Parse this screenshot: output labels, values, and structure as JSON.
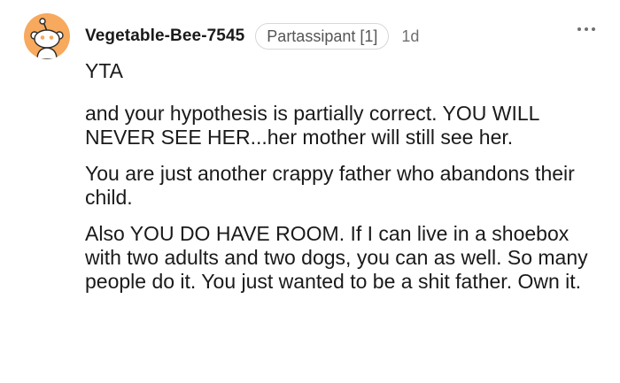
{
  "comment": {
    "username": "Vegetable-Bee-7545",
    "flair": "Partassipant [1]",
    "age": "1d",
    "more_icon": "more-horizontal-icon",
    "avatar_icon": "snoo-avatar-icon",
    "colors": {
      "avatar_bg": "#f7a95d",
      "text": "#1a1a1b",
      "meta": "#6f6f6f",
      "flair_border": "#d7d7d7"
    },
    "body": {
      "verdict": "YTA",
      "paragraphs": [
        "and your hypothesis is partially correct. YOU WILL NEVER SEE HER...her mother will still see her.",
        "You are just another crappy father who abandons their child.",
        "Also YOU DO HAVE ROOM. If I can live in a shoebox with two adults and two dogs, you can as well. So many people do it. You just wanted to be a shit father. Own it."
      ]
    }
  }
}
